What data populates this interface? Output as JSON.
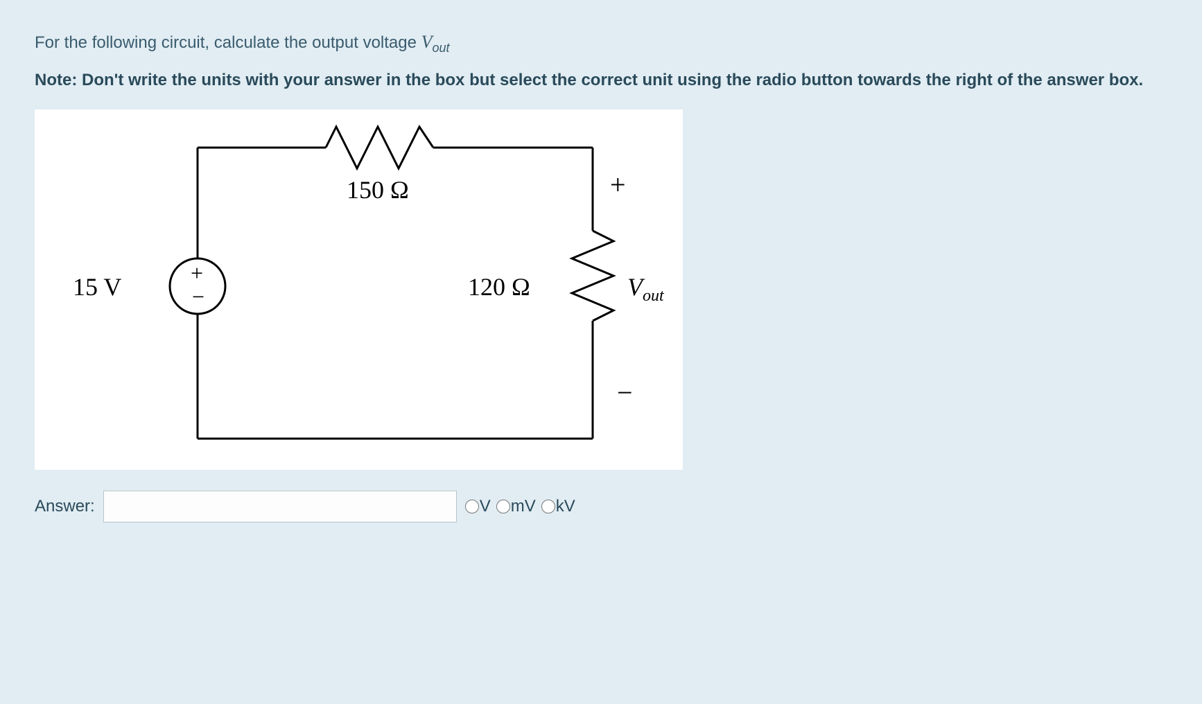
{
  "question": {
    "prefix": "For the following circuit, calculate the output voltage ",
    "var": "V",
    "sub": "out"
  },
  "note": "Note: Don't write the units with your answer in the box but select the correct unit using the radio button towards the right of the answer box.",
  "circuit": {
    "source_label": "15 V",
    "r1_label": "150 Ω",
    "r2_label": "120 Ω",
    "vout_label_var": "V",
    "vout_label_sub": "out",
    "plus": "+",
    "minus": "−",
    "src_plus": "+",
    "src_minus": "−"
  },
  "answer": {
    "label": "Answer:",
    "value": "",
    "placeholder": ""
  },
  "units": {
    "opt1": "V",
    "opt2": "mV",
    "opt3": "kV"
  }
}
